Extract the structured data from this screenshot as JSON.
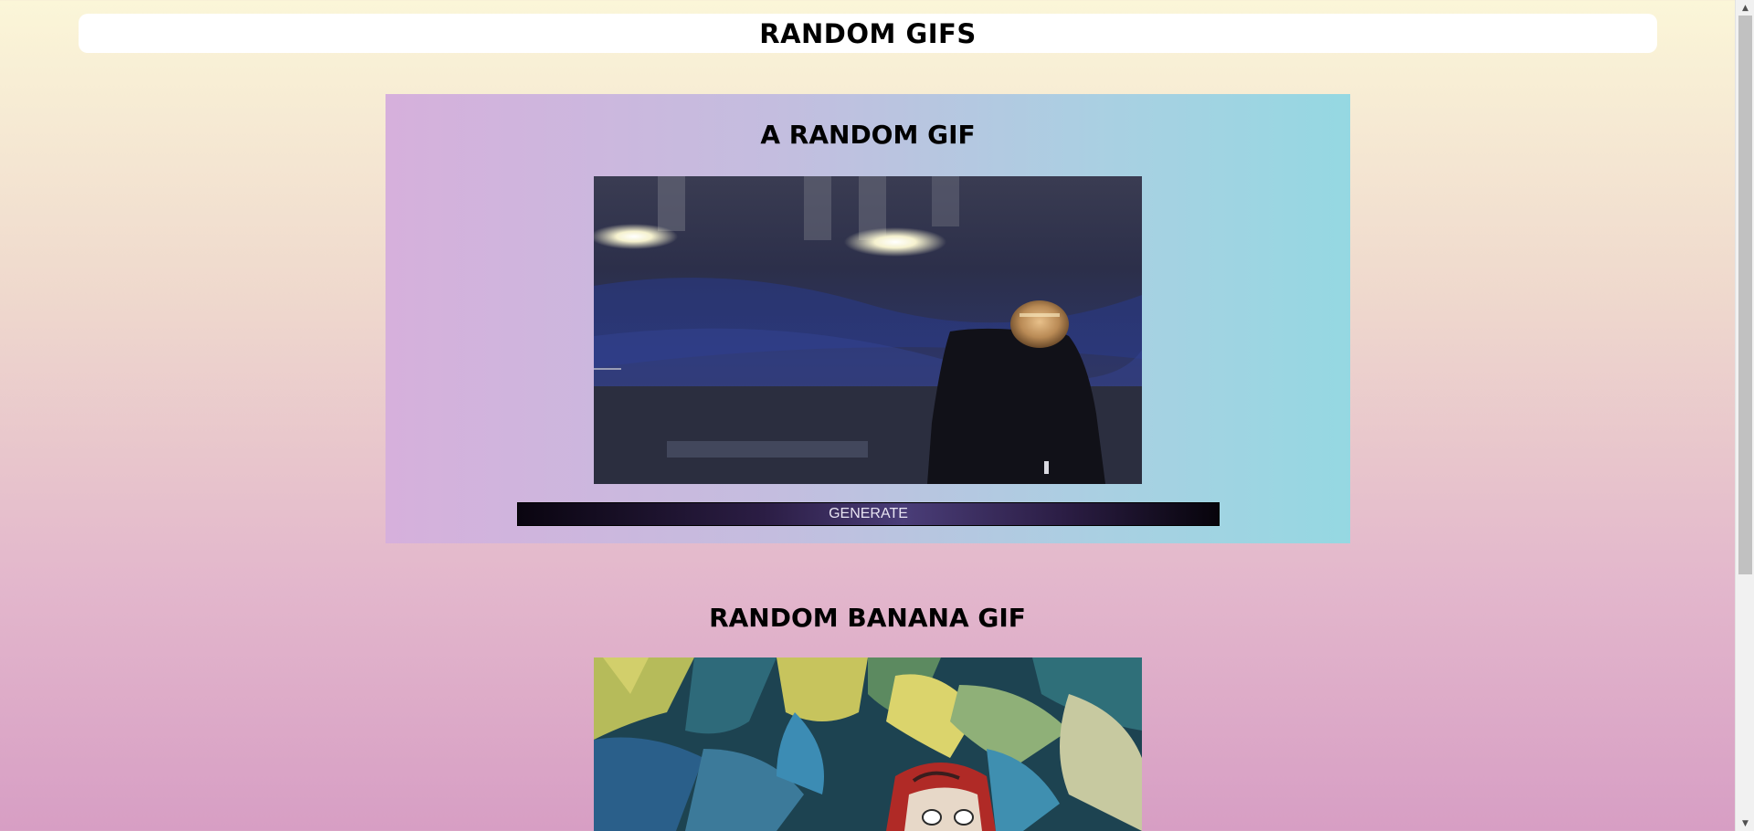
{
  "header": {
    "title": "RANDOM GIFS"
  },
  "random_gif": {
    "title": "A RANDOM GIF",
    "image_alt": "random-gif",
    "generate_label": "GENERATE"
  },
  "banana_gif": {
    "title": "RANDOM BANANA GIF",
    "image_alt": "banana-gif"
  },
  "scrollbar": {
    "up_icon": "▲",
    "down_icon": "▼"
  }
}
